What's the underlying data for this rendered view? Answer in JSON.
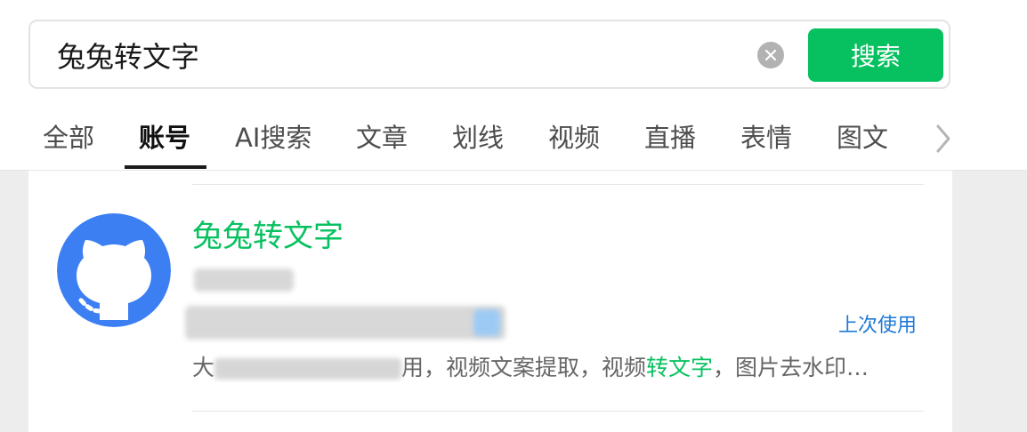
{
  "search": {
    "query": "兔兔转文字",
    "button_label": "搜索"
  },
  "tabs": [
    {
      "label": "全部",
      "active": false
    },
    {
      "label": "账号",
      "active": true
    },
    {
      "label": "AI搜索",
      "active": false
    },
    {
      "label": "文章",
      "active": false
    },
    {
      "label": "划线",
      "active": false
    },
    {
      "label": "视频",
      "active": false
    },
    {
      "label": "直播",
      "active": false
    },
    {
      "label": "表情",
      "active": false
    },
    {
      "label": "图文",
      "active": false
    }
  ],
  "result": {
    "account_name": "兔兔转文字",
    "last_used": "上次使用",
    "description": {
      "prefix": "大",
      "middle": "用，视频文案提取，视频",
      "highlight": "转文字",
      "suffix": "，图片去水印…"
    }
  },
  "colors": {
    "accent_green": "#07c160",
    "link_blue": "#1f7ad6",
    "avatar_blue": "#3c7ff2"
  },
  "icons": {
    "clear": "clear-icon",
    "tabs_more": "chevron-right-icon",
    "avatar": "github-octocat-icon"
  }
}
